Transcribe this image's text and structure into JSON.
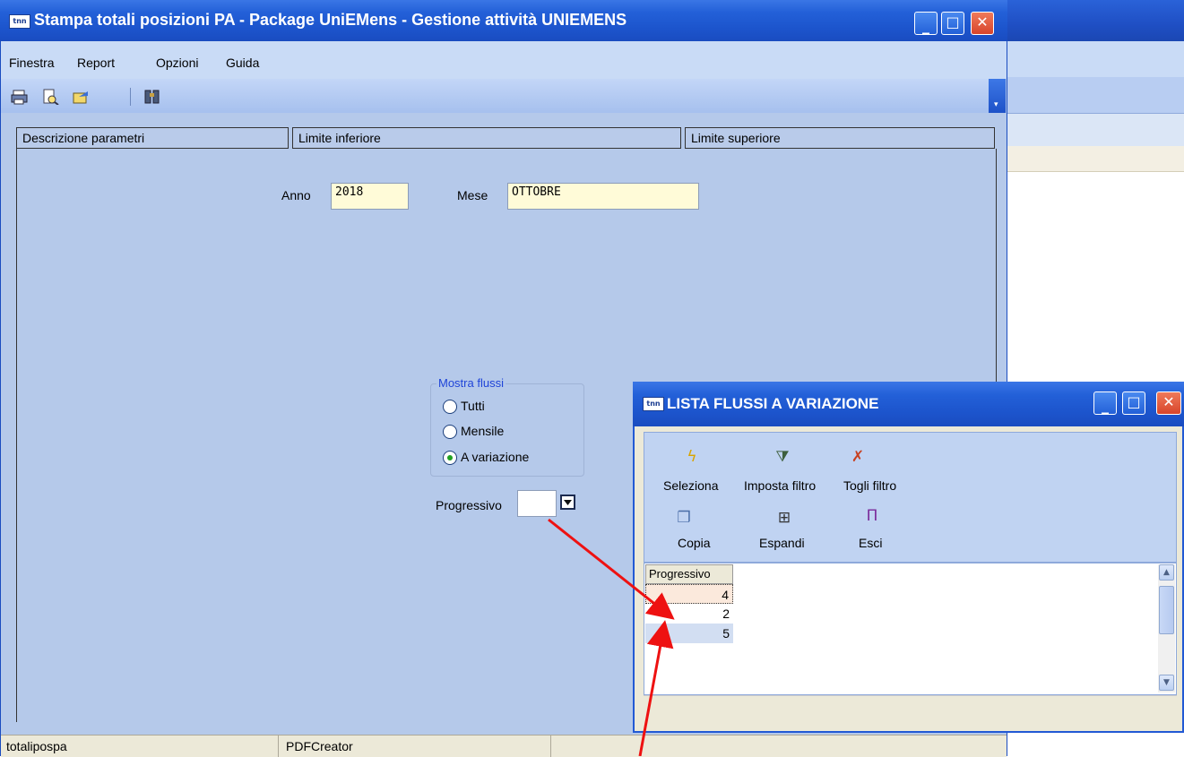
{
  "main_window": {
    "title": "Stampa totali posizioni PA - Package UniEMens - Gestione attività UNIEMENS",
    "app_icon": "tnn",
    "menu": [
      "Finestra",
      "Report",
      "Opzioni",
      "Guida"
    ],
    "toolbar_icons": [
      "printer-icon",
      "print-preview-icon",
      "export-icon",
      "binoculars-icon"
    ],
    "columns": [
      "Descrizione parametri",
      "Limite inferiore",
      "Limite superiore"
    ],
    "form": {
      "anno_label": "Anno",
      "anno_value": "2018",
      "mese_label": "Mese",
      "mese_value": "OTTOBRE",
      "group_title": "Mostra flussi",
      "radio_options": [
        "Tutti",
        "Mensile",
        "A variazione"
      ],
      "selected_option": "A variazione",
      "progressivo_label": "Progressivo",
      "progressivo_value": ""
    },
    "status_bar": [
      "totalipospa",
      "PDFCreator"
    ]
  },
  "popup": {
    "title": "LISTA FLUSSI A VARIAZIONE",
    "app_icon": "tnn",
    "commands_row1": [
      "Seleziona",
      "Imposta filtro",
      "Togli filtro"
    ],
    "commands_row2": [
      "Copia",
      "Espandi",
      "Esci"
    ],
    "grid_header": "Progressivo",
    "rows": [
      "4",
      "2",
      "5"
    ]
  },
  "colors": {
    "title_bar": "#2360d8",
    "form_background": "#b5c9ea",
    "field_background": "#fffbd8",
    "annotation_arrow": "#ee1111",
    "group_title": "#1f44d8"
  }
}
